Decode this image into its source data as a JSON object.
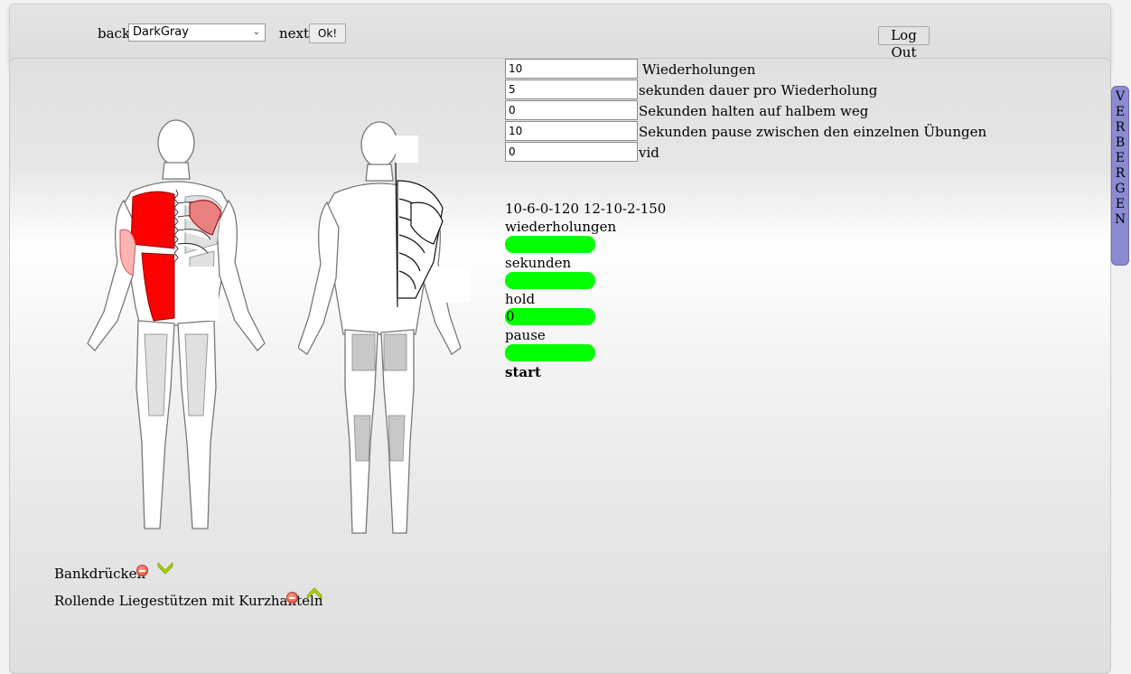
{
  "toolbar": {
    "back_label": "back",
    "color_select_value": "DarkGray",
    "next_label": "next",
    "ok_label": "Ok!",
    "logout_label": "Log Out"
  },
  "settings": [
    {
      "value": "10",
      "label": "Wiederholungen"
    },
    {
      "value": "5",
      "label": "sekunden dauer pro Wiederholung"
    },
    {
      "value": "0",
      "label": "Sekunden halten auf halbem weg"
    },
    {
      "value": "10",
      "label": "Sekunden pause zwischen den einzelnen Übungen"
    },
    {
      "value": "0",
      "label": "vid"
    }
  ],
  "presets": "10-6-0-120 12-10-2-150",
  "counters": [
    {
      "label": "wiederholungen",
      "value": ""
    },
    {
      "label": "sekunden",
      "value": ""
    },
    {
      "label": "hold",
      "value": "0"
    },
    {
      "label": "pause",
      "value": ""
    }
  ],
  "start_label": "start",
  "hide_tab_letters": [
    "V",
    "E",
    "R",
    "B",
    "E",
    "R",
    "G",
    "E",
    "N"
  ],
  "exercises": [
    {
      "name": "Bankdrücken",
      "move_icon": "chevron-down-icon"
    },
    {
      "name": "Rollende Liegestützen mit Kurzhanteln",
      "move_icon": "chevron-up-icon"
    }
  ],
  "colors": {
    "highlight_muscle": "#ff0000",
    "counter_bar": "#00ff00",
    "hide_tab": "#8b8bd2",
    "move_arrow": "#a8d400"
  }
}
